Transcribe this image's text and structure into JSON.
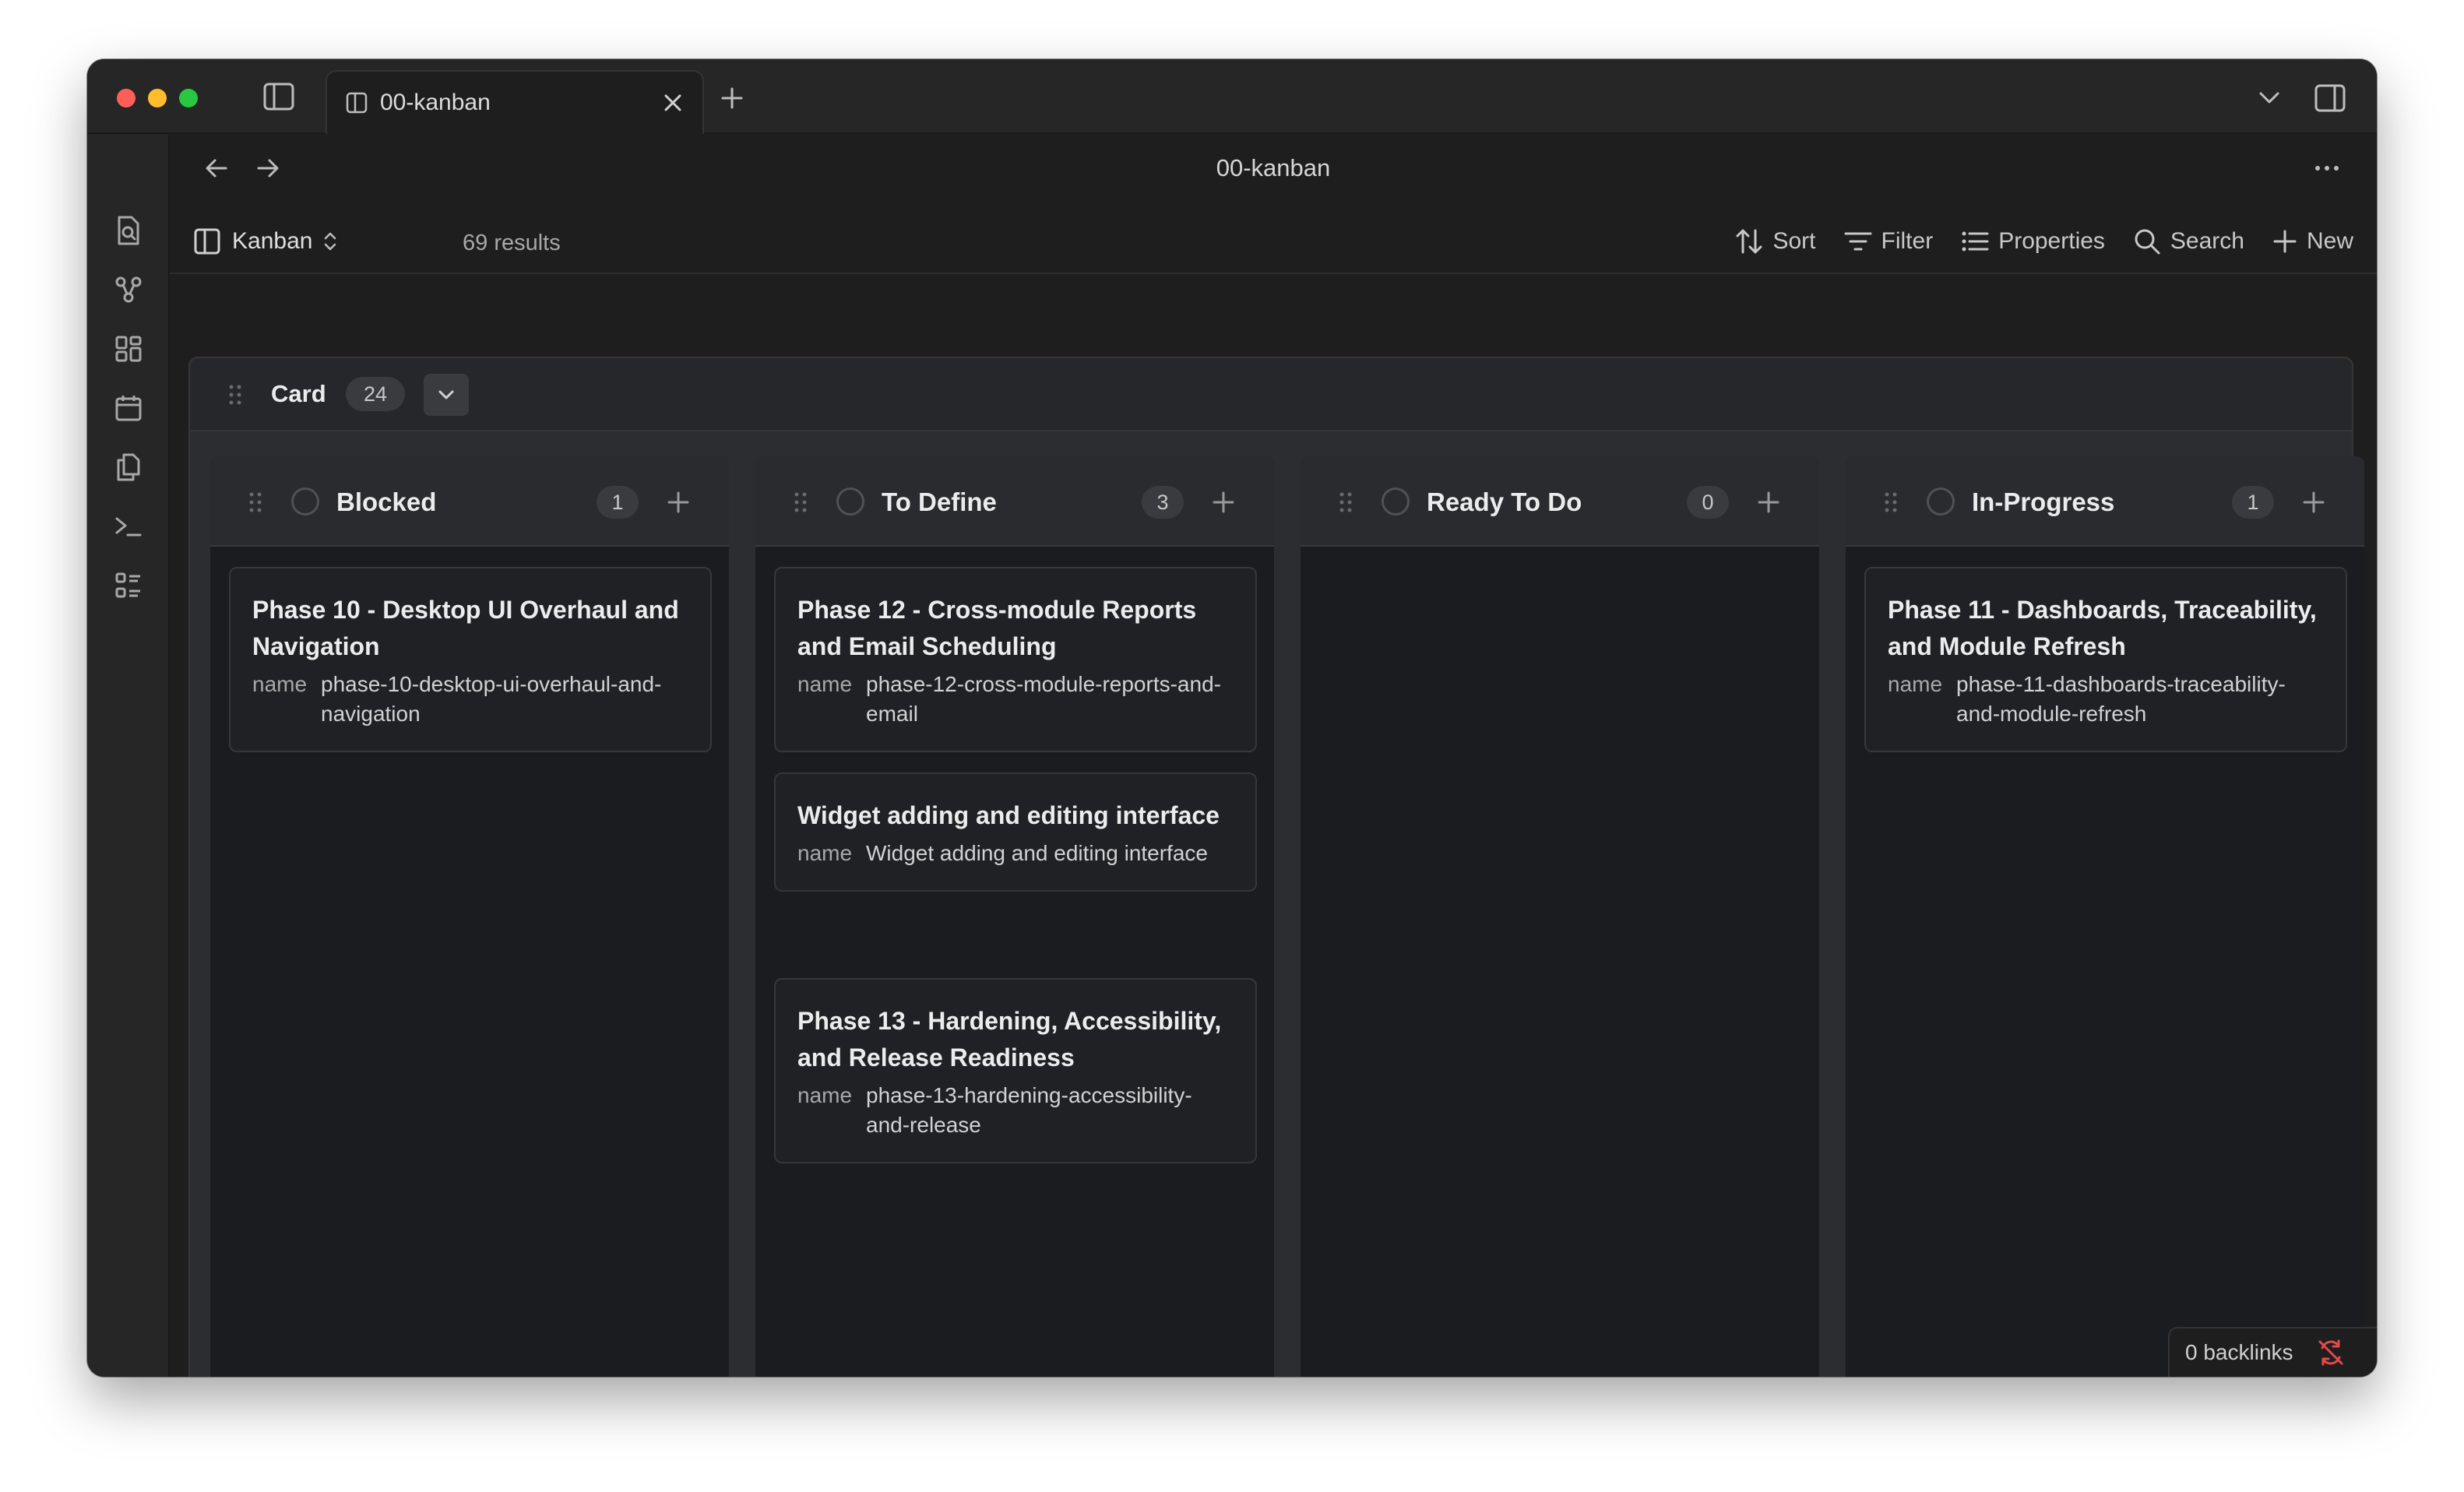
{
  "tab": {
    "title": "00-kanban"
  },
  "header": {
    "title": "00-kanban"
  },
  "toolbar": {
    "view_label": "Kanban",
    "results": "69 results",
    "sort": "Sort",
    "filter": "Filter",
    "properties": "Properties",
    "search": "Search",
    "new": "New"
  },
  "group": {
    "title": "Card",
    "count": "24"
  },
  "columns": [
    {
      "title": "Blocked",
      "count": "1",
      "cards": [
        {
          "title": "Phase 10 - Desktop UI Overhaul and Navigation",
          "prop_key": "name",
          "prop_value": "phase-10-desktop-ui-overhaul-and-navigation"
        }
      ]
    },
    {
      "title": "To Define",
      "count": "3",
      "cards": [
        {
          "title": "Phase 12 - Cross-module Reports and Email Scheduling",
          "prop_key": "name",
          "prop_value": "phase-12-cross-module-reports-and-email"
        },
        {
          "title": "Widget adding and editing interface",
          "prop_key": "name",
          "prop_value": "Widget adding and editing interface"
        },
        {
          "title": "Phase 13 - Hardening, Accessibility, and Release Readiness",
          "prop_key": "name",
          "prop_value": "phase-13-hardening-accessibility-and-release"
        }
      ]
    },
    {
      "title": "Ready To Do",
      "count": "0",
      "cards": []
    },
    {
      "title": "In-Progress",
      "count": "1",
      "cards": [
        {
          "title": "Phase 11 - Dashboards, Traceability, and Module Refresh",
          "prop_key": "name",
          "prop_value": "phase-11-dashboards-traceability-and-module-refresh"
        }
      ]
    }
  ],
  "status_bar": {
    "backlinks": "0 backlinks"
  },
  "colors": {
    "background": "#1e1e1e",
    "column": "#1b1c1f",
    "card": "#202124",
    "sync_error": "#e5484d"
  },
  "icons": {
    "ribbon": [
      "search-file-icon",
      "graph-icon",
      "bases-icon",
      "calendar-icon",
      "copy-icon",
      "terminal-icon",
      "list-icon"
    ]
  }
}
